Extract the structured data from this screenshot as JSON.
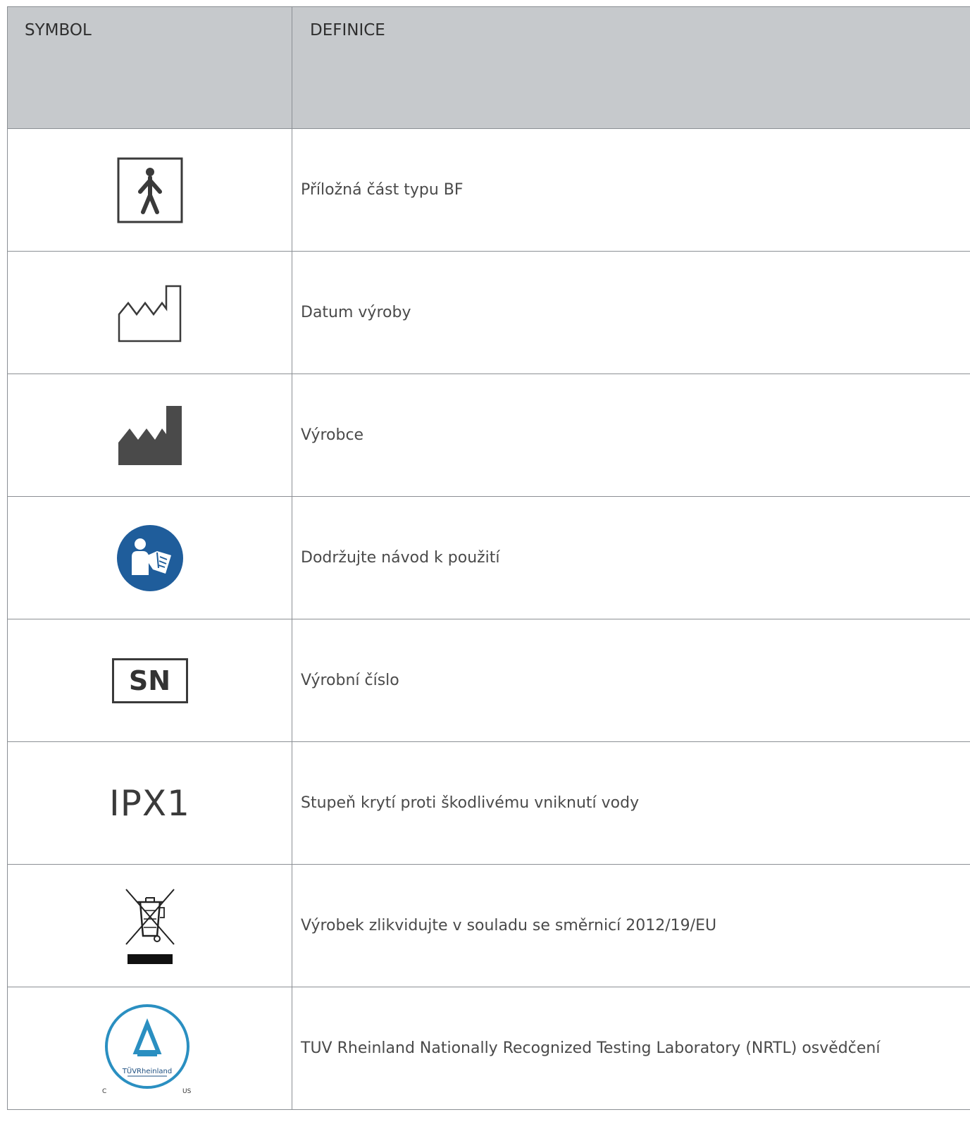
{
  "header": {
    "symbol": "SYMBOL",
    "definition": "DEFINICE"
  },
  "rows": [
    {
      "icon": "bf-applied-part-icon",
      "definition": "Příložná část typu BF"
    },
    {
      "icon": "manufacture-date-icon",
      "definition": "Datum výroby"
    },
    {
      "icon": "manufacturer-icon",
      "definition": "Výrobce"
    },
    {
      "icon": "follow-instructions-icon",
      "definition": "Dodržujte návod k použití"
    },
    {
      "icon": "serial-number-icon",
      "symbol_text": "SN",
      "definition": "Výrobní číslo"
    },
    {
      "icon": "ingress-protection-icon",
      "symbol_text": "IPX1",
      "definition": "Stupeň krytí proti škodlivému vniknutí vody"
    },
    {
      "icon": "weee-disposal-icon",
      "definition": "Výrobek zlikvidujte v souladu se směrnicí 2012/19/EU"
    },
    {
      "icon": "tuv-rheinland-icon",
      "logo_text": "TÜVRheinland",
      "logo_c": "C",
      "logo_us": "US",
      "definition": "TUV Rheinland Nationally Recognized Testing Laboratory (NRTL) osvědčení"
    }
  ],
  "colors": {
    "header_bg": "#c6c9cc",
    "grid": "#8b8f94",
    "info_blue": "#1f5d9b",
    "tuv_blue": "#2a8fc1",
    "icon_dark": "#4a4a4a"
  }
}
